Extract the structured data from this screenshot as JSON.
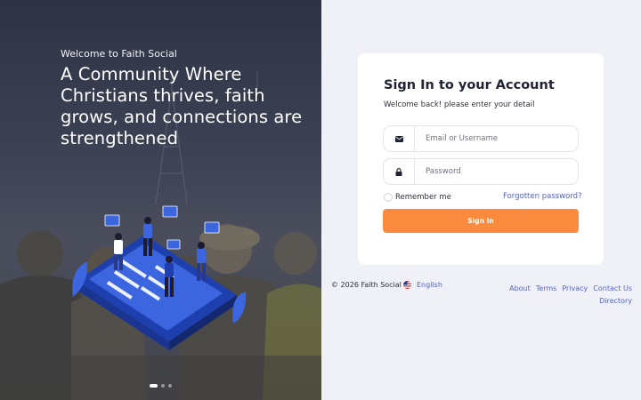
{
  "hero": {
    "eyebrow": "Welcome to Faith Social",
    "headline": "A Community Where Christians thrives, faith grows, and connections are strengthened",
    "carousel": {
      "slides": 3,
      "active": 1
    }
  },
  "login": {
    "title": "Sign In to your Account",
    "subtitle": "Welcome back! please enter your detail",
    "username_placeholder": "Email or Username",
    "password_placeholder": "Password",
    "remember_label": "Remember me",
    "forgot_label": "Forgotten password?",
    "submit_label": "Sign In"
  },
  "footer": {
    "copyright": "© 2026 Faith Social",
    "language": "English",
    "links": [
      "About",
      "Terms",
      "Privacy",
      "Contact Us",
      "Directory"
    ]
  },
  "icons": {
    "username": "envelope-icon",
    "password": "lock-icon",
    "language": "us-flag-icon"
  },
  "colors": {
    "accent": "#fa8a3e",
    "link": "#5563c7",
    "hero_overlay": "#3b4053"
  }
}
